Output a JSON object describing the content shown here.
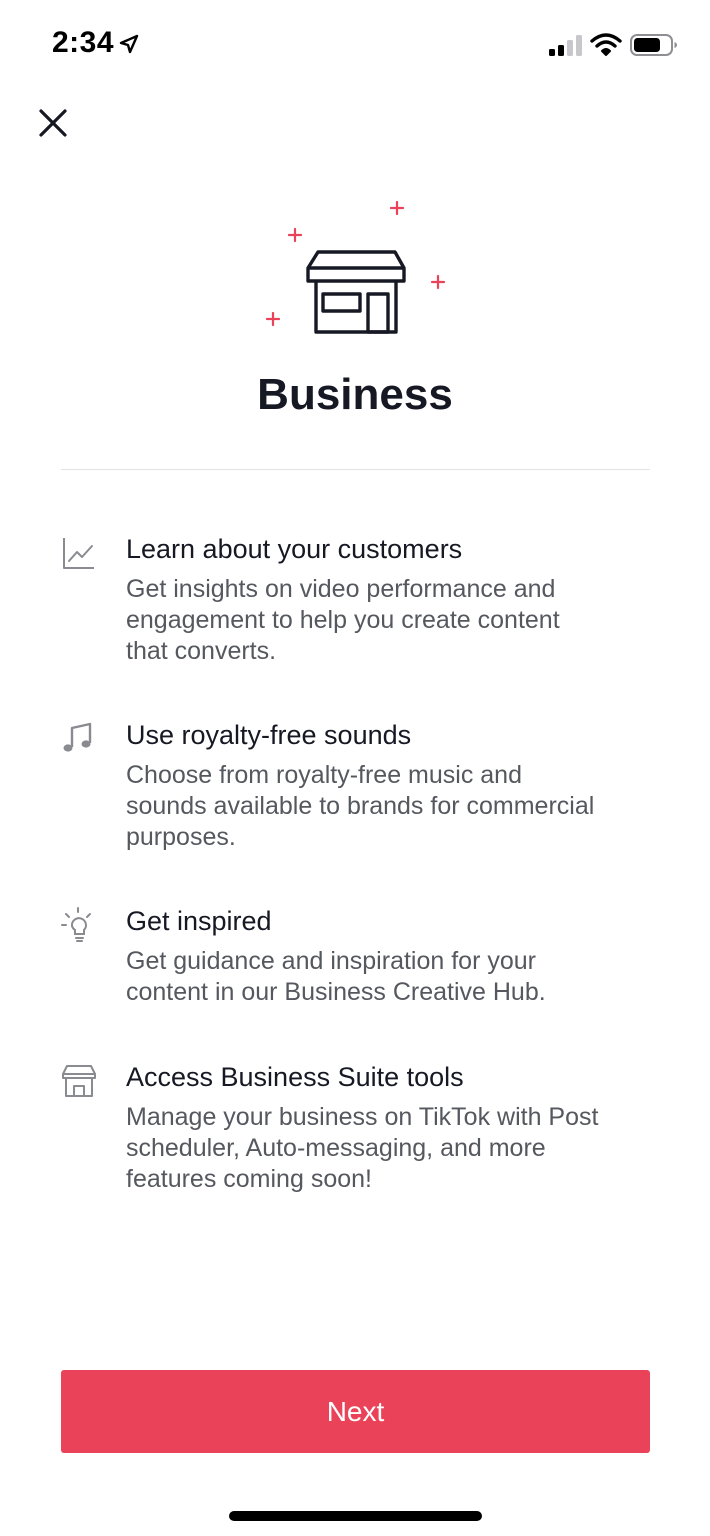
{
  "status_bar": {
    "time": "2:34",
    "icons": [
      "location-arrow-icon",
      "cellular-signal-icon",
      "wifi-icon",
      "battery-icon"
    ]
  },
  "header": {
    "close_icon": "close-icon"
  },
  "hero": {
    "icon": "storefront-icon",
    "title": "Business",
    "accent_color": "#ea4359"
  },
  "features": [
    {
      "icon": "line-chart-icon",
      "title": "Learn about your customers",
      "description_lines": [
        "Get insights on video performance and",
        "engagement to help you create content",
        "that converts."
      ]
    },
    {
      "icon": "music-note-icon",
      "title": "Use royalty-free sounds",
      "description_lines": [
        "Choose from royalty-free music and",
        "sounds available to brands for commercial",
        "purposes."
      ]
    },
    {
      "icon": "lightbulb-icon",
      "title": "Get inspired",
      "description_lines": [
        "Get guidance and inspiration for your",
        "content in our Business Creative Hub."
      ]
    },
    {
      "icon": "shop-icon",
      "title": "Access Business Suite tools",
      "description_lines": [
        "Manage your business on TikTok with Post",
        "scheduler, Auto-messaging, and more",
        "features coming soon!"
      ]
    }
  ],
  "footer": {
    "next_label": "Next",
    "button_color": "#ea4359"
  }
}
